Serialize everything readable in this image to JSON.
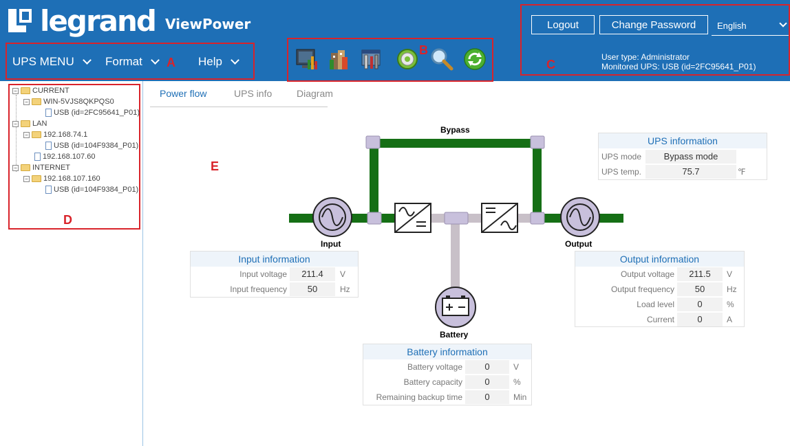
{
  "brand": {
    "name": "legrand",
    "product": "ViewPower"
  },
  "menu": {
    "items": [
      "UPS MENU",
      "Format",
      "Help"
    ]
  },
  "annotations": {
    "a": "A",
    "b": "B",
    "c": "C",
    "d": "D",
    "e": "E"
  },
  "toolbar": {
    "icons": [
      "monitor-chart-icon",
      "building-icon",
      "config-tools-icon",
      "settings-gear-icon",
      "search-icon",
      "refresh-icon"
    ]
  },
  "header": {
    "logout": "Logout",
    "change_password": "Change Password",
    "language": "English",
    "user_type": "User type: Administrator",
    "monitored_ups": "Monitored UPS: USB (id=2FC95641_P01)"
  },
  "tree": {
    "current": "CURRENT",
    "win": "WIN-5VJS8QKPQS0",
    "usb1": "USB (id=2FC95641_P01)",
    "lan": "LAN",
    "ip1": "192.168.74.1",
    "usb2": "USB (id=104F9384_P01)",
    "ip2": "192.168.107.60",
    "internet": "INTERNET",
    "ip3": "192.168.107.160",
    "usb3": "USB (id=104F9384_P01)"
  },
  "tabs": [
    "Power flow",
    "UPS info",
    "Diagram"
  ],
  "active_tab": "Power flow",
  "flow": {
    "bypass": "Bypass",
    "input": "Input",
    "output": "Output",
    "battery": "Battery"
  },
  "ups_info": {
    "title": "UPS information",
    "mode_label": "UPS mode",
    "mode_value": "Bypass mode",
    "temp_label": "UPS temp.",
    "temp_value": "75.7",
    "temp_unit": "℉"
  },
  "input_info": {
    "title": "Input information",
    "rows": [
      {
        "label": "Input voltage",
        "value": "211.4",
        "unit": "V"
      },
      {
        "label": "Input frequency",
        "value": "50",
        "unit": "Hz"
      }
    ]
  },
  "output_info": {
    "title": "Output information",
    "rows": [
      {
        "label": "Output voltage",
        "value": "211.5",
        "unit": "V"
      },
      {
        "label": "Output frequency",
        "value": "50",
        "unit": "Hz"
      },
      {
        "label": "Load level",
        "value": "0",
        "unit": "%"
      },
      {
        "label": "Current",
        "value": "0",
        "unit": "A"
      }
    ]
  },
  "battery_info": {
    "title": "Battery information",
    "rows": [
      {
        "label": "Battery voltage",
        "value": "0",
        "unit": "V"
      },
      {
        "label": "Battery capacity",
        "value": "0",
        "unit": "%"
      },
      {
        "label": "Remaining backup time",
        "value": "0",
        "unit": "Min"
      }
    ]
  },
  "colors": {
    "header": "#1e6fb6",
    "active_flow": "#1a7a1a",
    "inactive_flow": "#c8c0c8",
    "annotation": "#d9232a",
    "node": "#c8c0dc"
  }
}
